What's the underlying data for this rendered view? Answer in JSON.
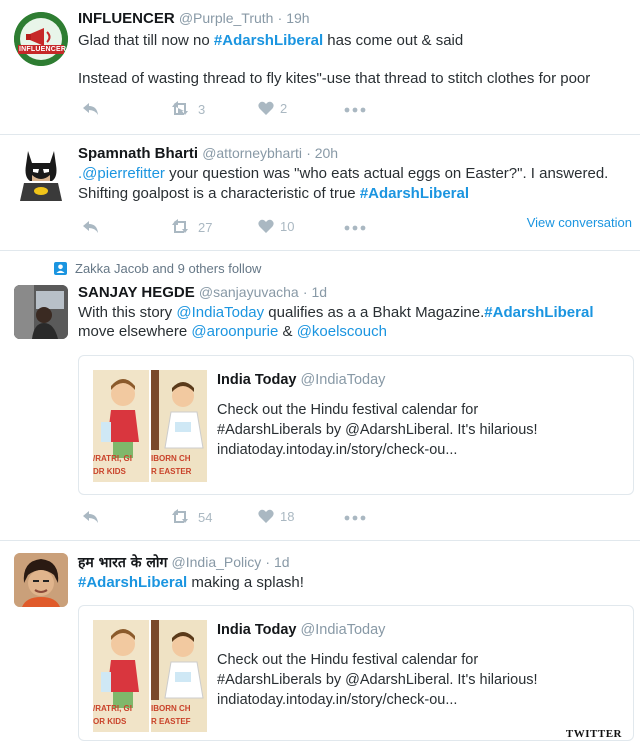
{
  "tweets": [
    {
      "name": "INFLUENCER",
      "handle": "@Purple_Truth",
      "time": "· 19h",
      "avatar_label": "INFLUENCER",
      "line1_pre": "Glad that till now no ",
      "line1_tag": "#AdarshLiberal",
      "line1_post": " has come out & said",
      "line2": "Instead of wasting thread to fly kites\"-use that thread to stitch clothes for poor",
      "retweets": "3",
      "likes": "2"
    },
    {
      "name": "Spamnath Bharti",
      "handle": "@attorneybharti",
      "time": "· 20h",
      "line1_mention": ".@pierrefitter",
      "line1_post": " your question was \"who eats actual eggs on Easter?\". I answered.",
      "line2_pre": "Shifting goalpost is a characteristic of true ",
      "line2_tag": "#AdarshLiberal",
      "retweets": "27",
      "likes": "10",
      "view_conversation": "View conversation"
    },
    {
      "context": "Zakka Jacob and 9 others follow",
      "name": "SANJAY HEGDE",
      "handle": "@sanjayuvacha",
      "time": "· 1d",
      "line1_pre": "With this story ",
      "line1_mention": "@IndiaToday",
      "line1_mid": " qualifies as a a Bhakt Magazine.",
      "line1_tag": "#AdarshLiberal",
      "line2_pre": "move elsewhere ",
      "line2_mention1": "@aroonpurie",
      "line2_mid": " & ",
      "line2_mention2": "@koelscouch",
      "retweets": "54",
      "likes": "18"
    },
    {
      "name": "हम भारत के लोग",
      "handle": "@India_Policy",
      "time": "· 1d",
      "line1_tag": "#AdarshLiberal",
      "line1_post": " making a splash!"
    }
  ],
  "card": {
    "title": "India Today",
    "handle": "@IndiaToday",
    "line1": "Check out the Hindu festival calendar for",
    "line2": "#AdarshLiberals by @AdarshLiberal. It's hilarious!",
    "line3": "indiatoday.intoday.in/story/check-ou...",
    "thumb_left_1": "/RATRI, GI",
    "thumb_left_2": "DR KIDS",
    "thumb_right_1": "IBORN CH",
    "thumb_right_2": "R EASTER"
  },
  "card2": {
    "title": "India Today",
    "handle": "@IndiaToday",
    "line1": "Check out the Hindu festival calendar for",
    "line2": "#AdarshLiberals by @AdarshLiberal. It's hilarious!",
    "line3": "indiatoday.intoday.in/story/check-ou...",
    "thumb_left_1": "/RATRI, GI",
    "thumb_left_2": "OR KIDS",
    "thumb_right_1": "IBORN CH",
    "thumb_right_2": "R EASTEF"
  },
  "watermark": "TWITTER",
  "colors": {
    "link": "#1b95e0",
    "icon": "#aab8c2",
    "muted": "#8899a6"
  }
}
